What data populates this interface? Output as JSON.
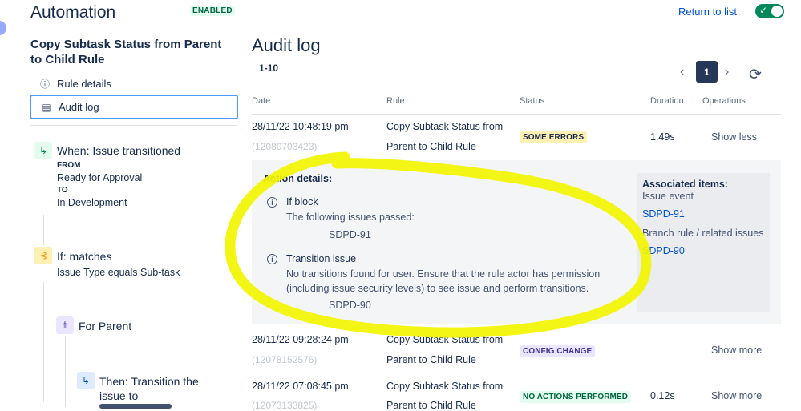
{
  "header": {
    "title": "Automation",
    "status_badge": "ENABLED",
    "return_link": "Return to list",
    "toggle_state": "on"
  },
  "sidebar": {
    "rule_name": "Copy Subtask Status from Parent to Child Rule",
    "items": [
      {
        "label": "Rule details",
        "icon": "info-icon"
      },
      {
        "label": "Audit log",
        "icon": "document-icon",
        "active": true
      }
    ],
    "steps": {
      "trigger": {
        "title": "When: Issue transitioned",
        "from_label": "FROM",
        "from_value": "Ready for Approval",
        "to_label": "TO",
        "to_value": "In Development",
        "icon": "trigger-icon"
      },
      "condition": {
        "title": "If: matches",
        "desc": "Issue Type equals Sub-task",
        "icon": "condition-branch-icon"
      },
      "branch": {
        "title": "For Parent",
        "icon": "hierarchy-icon"
      },
      "action": {
        "title": "Then: Transition the issue to",
        "icon": "action-icon"
      }
    }
  },
  "audit": {
    "title": "Audit log",
    "range": "1-10",
    "pager": {
      "current_page": "1"
    },
    "columns": [
      "Date",
      "Rule",
      "Status",
      "Duration",
      "Operations"
    ],
    "rows": [
      {
        "date": "28/11/22 10:48:19 pm",
        "id": "(12080703423)",
        "rule_line1": "Copy Subtask Status from",
        "rule_line2": "Parent to Child Rule",
        "status": "SOME ERRORS",
        "duration": "1.49s",
        "operation": "Show less"
      },
      {
        "date": "28/11/22 09:28:24 pm",
        "id": "(12078152576)",
        "rule_line1": "Copy Subtask Status from",
        "rule_line2": "Parent to Child Rule",
        "status": "CONFIG CHANGE",
        "duration": "",
        "operation": "Show more"
      },
      {
        "date": "28/11/22 07:08:45 pm",
        "id": "(12073133825)",
        "rule_line1": "Copy Subtask Status from",
        "rule_line2": "Parent to Child Rule",
        "status": "NO ACTIONS PERFORMED",
        "duration": "0.12s",
        "operation": "Show more"
      }
    ],
    "details": {
      "heading": "Action details:",
      "actions": [
        {
          "title": "If block",
          "message": "The following issues passed:",
          "issue": "SDPD-91"
        },
        {
          "title": "Transition issue",
          "message_line1": "No transitions found for user. Ensure that the rule actor has permission",
          "message_line2": "(including issue security levels) to see issue and perform transitions.",
          "issue": "SDPD-90"
        }
      ],
      "associated": {
        "heading": "Associated items:",
        "event_label": "Issue event",
        "event_issue": "SDPD-91",
        "branch_label": "Branch rule / related issues",
        "branch_issue": "SDPD-90"
      }
    }
  },
  "colors": {
    "link": "#0052cc",
    "enabled_green": "#00875a",
    "warning_lozenge": "#fff0b3",
    "highlight_scribble": "#f2f500"
  }
}
